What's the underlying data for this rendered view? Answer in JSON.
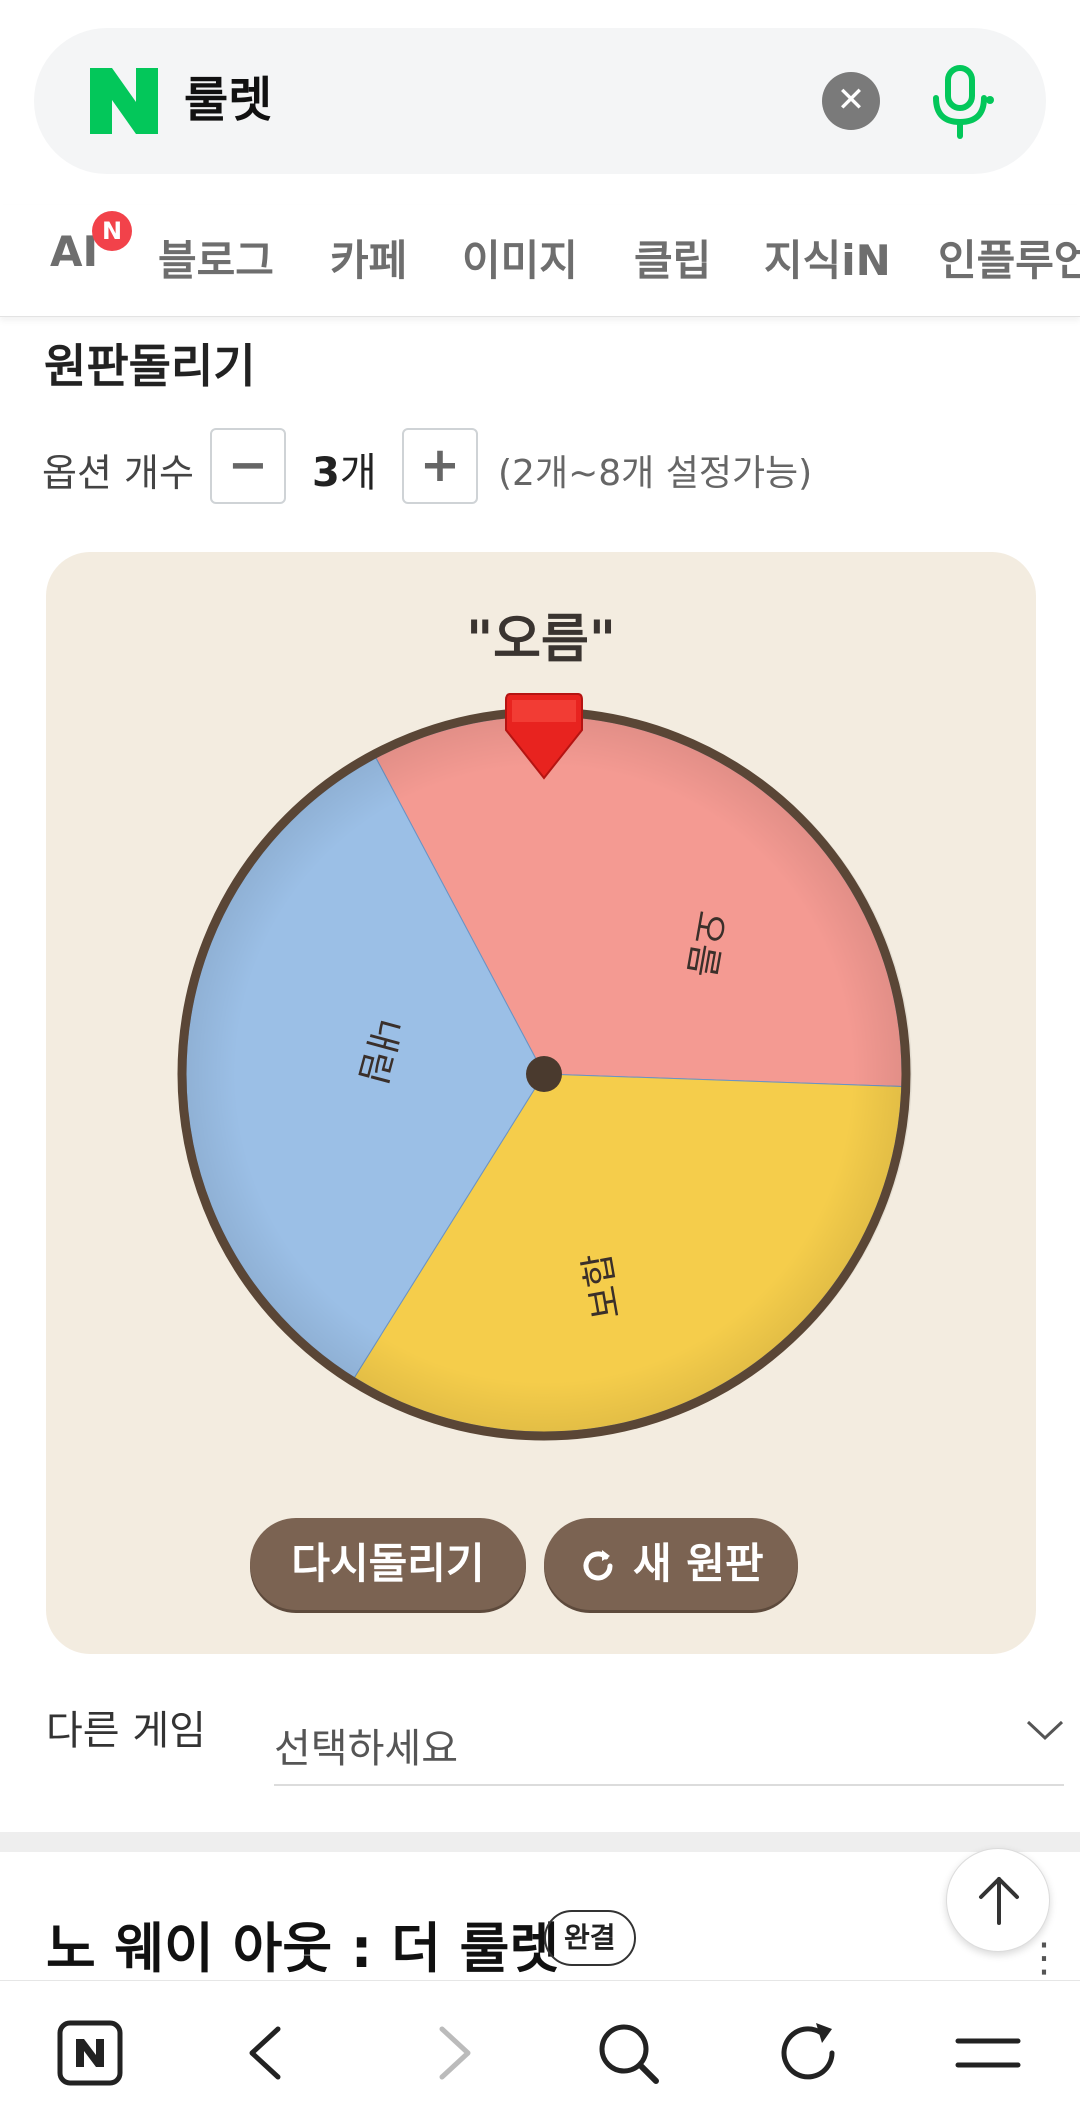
{
  "search": {
    "query": "룰렛",
    "logo_icon": "naver-n-icon",
    "clear_icon": "close-icon",
    "mic_icon": "microphone-icon",
    "accent_color": "#03c75a"
  },
  "tabs": [
    {
      "label": "AI",
      "badge": "N"
    },
    {
      "label": "블로그"
    },
    {
      "label": "카페"
    },
    {
      "label": "이미지"
    },
    {
      "label": "클립"
    },
    {
      "label": "지식iN"
    },
    {
      "label": "인플루언"
    }
  ],
  "roulette": {
    "title": "원판돌리기",
    "option_label": "옵션 개수",
    "minus_label": "−",
    "plus_label": "+",
    "count_value": "3",
    "count_unit": "개",
    "range_hint": "(2개~8개 설정가능)",
    "result": "\"오름\"",
    "segments": [
      {
        "label": "오름",
        "color": "#f49a92"
      },
      {
        "label": "보합",
        "color": "#f5cd4b"
      },
      {
        "label": "내림",
        "color": "#9bbfe6"
      }
    ],
    "pointer_color": "#e8231f",
    "spin_again_label": "다시돌리기",
    "new_wheel_label": "새 원판"
  },
  "other_game": {
    "label": "다른 게임",
    "placeholder": "선택하세요"
  },
  "result_item": {
    "title": "노 웨이 아웃 : 더 룰렛",
    "badge": "완결"
  },
  "bottom_nav": [
    "naver-home-icon",
    "back-icon",
    "forward-icon",
    "search-icon",
    "refresh-icon",
    "menu-icon"
  ]
}
